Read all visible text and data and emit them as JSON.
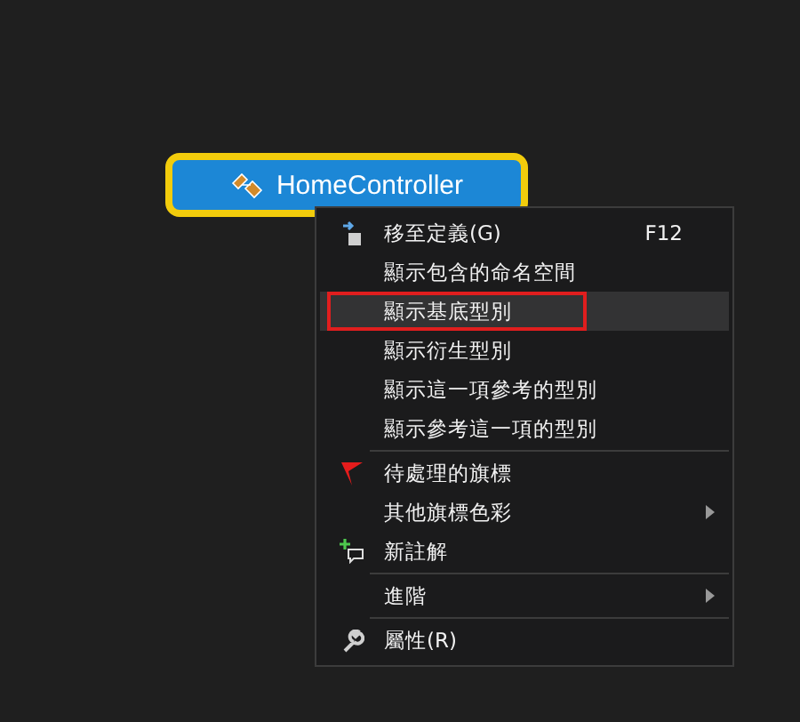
{
  "node": {
    "title": "HomeController",
    "selected": true
  },
  "menu": [
    {
      "kind": "item",
      "label": "移至定義(G)",
      "shortcut": "F12",
      "selected": false,
      "annotated": false,
      "submenu": false
    },
    {
      "kind": "item",
      "label": "顯示包含的命名空間",
      "selected": false,
      "annotated": false,
      "submenu": false
    },
    {
      "kind": "item",
      "label": "顯示基底型別",
      "selected": true,
      "annotated": true,
      "submenu": false
    },
    {
      "kind": "item",
      "label": "顯示衍生型別",
      "selected": false,
      "annotated": false,
      "submenu": false
    },
    {
      "kind": "item",
      "label": "顯示這一項參考的型別",
      "selected": false,
      "annotated": false,
      "submenu": false
    },
    {
      "kind": "item",
      "label": "顯示參考這一項的型別",
      "selected": false,
      "annotated": false,
      "submenu": false
    },
    {
      "kind": "separator"
    },
    {
      "kind": "item",
      "label": "待處理的旗標",
      "selected": false,
      "annotated": false,
      "submenu": false
    },
    {
      "kind": "item",
      "label": "其他旗標色彩",
      "selected": false,
      "annotated": false,
      "submenu": true
    },
    {
      "kind": "item",
      "label": "新註解",
      "selected": false,
      "annotated": false,
      "submenu": false
    },
    {
      "kind": "separator"
    },
    {
      "kind": "item",
      "label": "進階",
      "selected": false,
      "annotated": false,
      "submenu": true
    },
    {
      "kind": "separator"
    },
    {
      "kind": "item",
      "label": "屬性(R)",
      "selected": false,
      "annotated": false,
      "submenu": false
    }
  ]
}
